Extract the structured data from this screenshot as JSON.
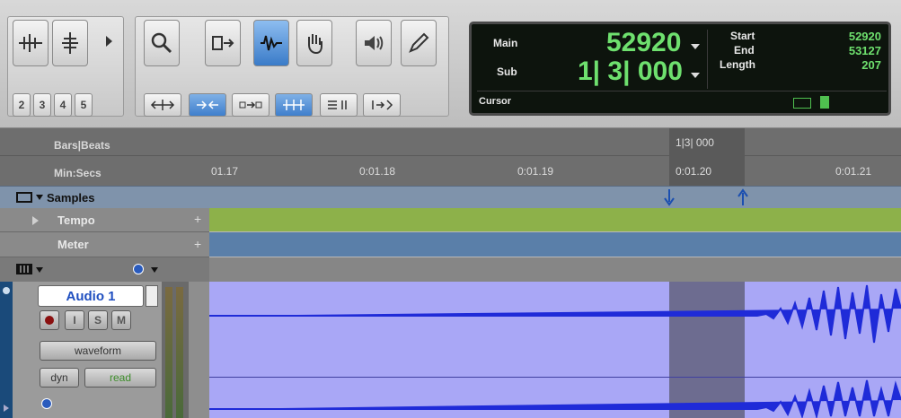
{
  "toolbar": {
    "num_buttons": [
      "2",
      "3",
      "4",
      "5"
    ]
  },
  "counter": {
    "main_label": "Main",
    "main_value": "52920",
    "sub_label": "Sub",
    "sub_value": "1| 3| 000",
    "cursor_label": "Cursor",
    "start_label": "Start",
    "start_value": "52920",
    "end_label": "End",
    "end_value": "53127",
    "length_label": "Length",
    "length_value": "207"
  },
  "rulers": {
    "bars_beats_label": "Bars|Beats",
    "bars_beats_marker": "1|3| 000",
    "minsecs_label": "Min:Secs",
    "ticks": [
      "01.17",
      "0:01.18",
      "0:01.19",
      "0:01.20",
      "0:01.21"
    ],
    "samples_label": "Samples",
    "tempo_label": "Tempo",
    "meter_label": "Meter"
  },
  "track": {
    "name": "Audio 1",
    "rec": "",
    "input": "I",
    "solo": "S",
    "mute": "M",
    "view": "waveform",
    "dyn": "dyn",
    "automation": "read"
  },
  "colors": {
    "tempo": "#8db14a",
    "meter": "#5a7fa9",
    "region": "#a9a7f6",
    "waveform": "#1f2bd8",
    "counter_green": "#6ee06e"
  }
}
